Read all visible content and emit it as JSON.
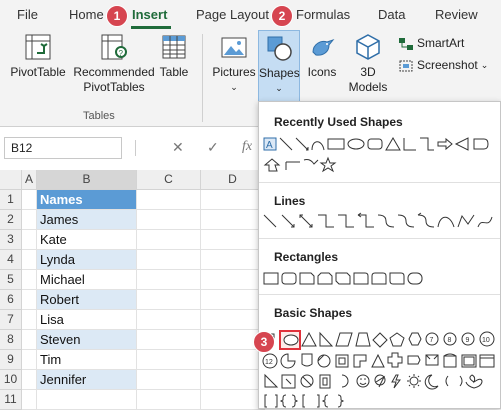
{
  "tabs": [
    "File",
    "Home",
    "Insert",
    "Page Layout",
    "Formulas",
    "Data",
    "Review"
  ],
  "badges": [
    "1",
    "2",
    "3"
  ],
  "ribbon": {
    "pivottable": "PivotTable",
    "recommended_1": "Recommended",
    "recommended_2": "PivotTables",
    "table": "Table",
    "tables_group": "Tables",
    "pictures": "Pictures",
    "shapes": "Shapes",
    "icons": "Icons",
    "models_1": "3D",
    "models_2": "Models",
    "smartart": "SmartArt",
    "screenshot": "Screenshot"
  },
  "formula_bar": {
    "name_box": "B12",
    "cancel": "✕",
    "enter": "✓",
    "fx": "fx"
  },
  "sheet": {
    "columns": [
      "A",
      "B",
      "C",
      "D"
    ],
    "rows": [
      "1",
      "2",
      "3",
      "4",
      "5",
      "6",
      "7",
      "8",
      "9",
      "10",
      "11"
    ],
    "header_cell": "Names",
    "names": [
      "James",
      "Kate",
      "Lynda",
      "Michael",
      "Robert",
      "Lisa",
      "Steven",
      "Tim",
      "Jennifer"
    ]
  },
  "shapes_panel": {
    "recent": "Recently Used Shapes",
    "lines": "Lines",
    "rectangles": "Rectangles",
    "basic": "Basic Shapes"
  },
  "colors": {
    "accent": "#1f6b3a",
    "badge": "#d64550",
    "header_fill": "#5b9bd5",
    "band_fill": "#dce9f5"
  }
}
